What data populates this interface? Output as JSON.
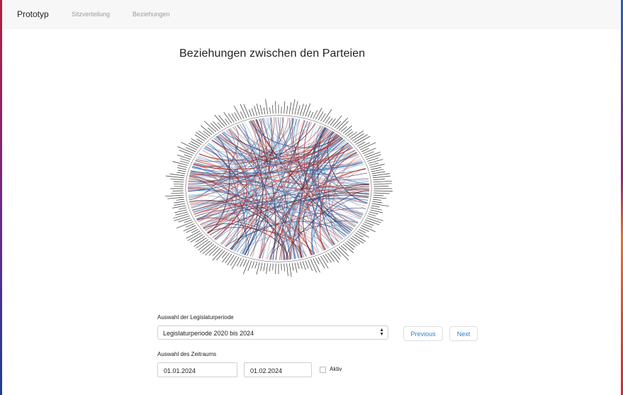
{
  "navbar": {
    "brand": "Prototyp",
    "links": [
      "Sitzverteilung",
      "Beziehungen"
    ]
  },
  "page": {
    "title": "Beziehungen zwischen den Parteien"
  },
  "chord": {
    "colors": {
      "blue": "#2e6bb0",
      "red": "#b0302e",
      "dark": "#3a1f3a",
      "light_blue": "#9ec3e0"
    }
  },
  "form": {
    "period_label": "Auswahl der Legislaturperiode",
    "period_value": "Legislaturperiode 2020 bis 2024",
    "previous_label": "Previous",
    "next_label": "Next",
    "range_label": "Auswahl des Zeitraums",
    "date_from": "01.01.2024",
    "date_to": "01.02.2024",
    "active_label": "Aktiv",
    "active_checked": false
  }
}
